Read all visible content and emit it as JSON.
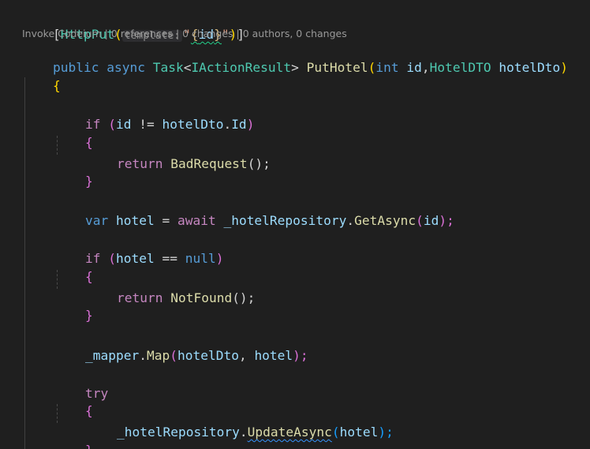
{
  "attribute": {
    "open": "[",
    "name": "HttpPut",
    "paren_open": "(",
    "param_hint": "template:",
    "string_quote_open": "\"",
    "route_brace_open": "{",
    "route_id": "id",
    "route_brace_close": "}",
    "string_quote_close": "\"",
    "paren_close": ")",
    "close": "]"
  },
  "codelens": "Invoke Codeium | 0 references | 0 changes | 0 authors, 0 changes",
  "signature": {
    "public": "public",
    "async": "async",
    "task": "Task",
    "lt": "<",
    "iaction": "IActionResult",
    "gt": ">",
    "method": "PutHotel",
    "paren_open": "(",
    "int": "int",
    "id": "id",
    "comma": ",",
    "dto_type": "HotelDTO",
    "dto_param": "hotelDto",
    "paren_close": ")"
  },
  "brace_open": "{",
  "brace_close": "}",
  "if1": {
    "kw": "if",
    "open": "(",
    "id": "id",
    "op": " != ",
    "obj": "hotelDto",
    "dot": ".",
    "prop": "Id",
    "close": ")"
  },
  "return1": {
    "kw": "return",
    "fn": "BadRequest",
    "rest": "();"
  },
  "var_line": {
    "kw": "var",
    "name": "hotel",
    "eq": " = ",
    "await": "await",
    "repo": "_hotelRepository",
    "dot": ".",
    "fn": "GetAsync",
    "open": "(",
    "arg": "id",
    "close": ");"
  },
  "if2": {
    "kw": "if",
    "open": "(",
    "var": "hotel",
    "op": " == ",
    "null": "null",
    "close": ")"
  },
  "return2": {
    "kw": "return",
    "fn": "NotFound",
    "rest": "();"
  },
  "mapper_line": {
    "obj": "_mapper",
    "dot": ".",
    "fn": "Map",
    "open": "(",
    "arg1": "hotelDto",
    "comma": ", ",
    "arg2": "hotel",
    "close": ");"
  },
  "try_kw": "try",
  "update_line": {
    "repo": "_hotelRepository",
    "dot": ".",
    "fn": "UpdateAsync",
    "open": "(",
    "arg": "hotel",
    "close": ");"
  }
}
